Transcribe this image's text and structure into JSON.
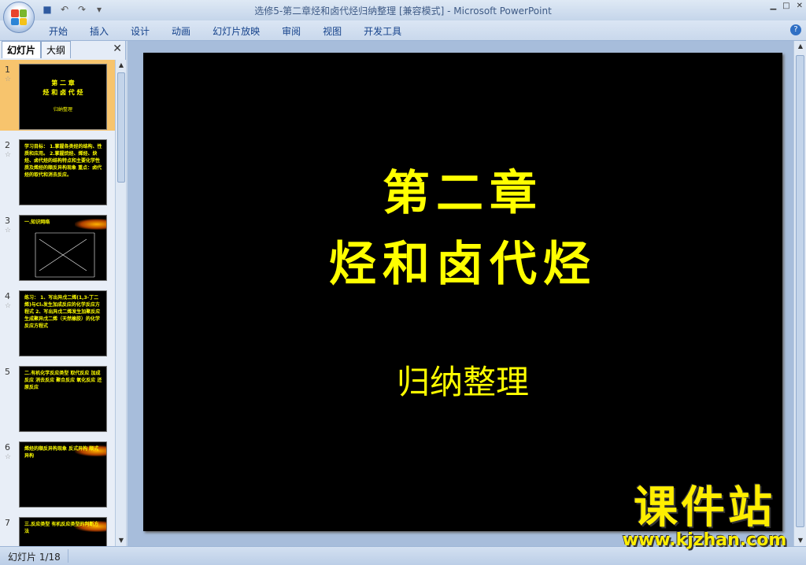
{
  "window": {
    "title": "选修5-第二章烃和卤代烃归纳整理 [兼容模式] - Microsoft PowerPoint"
  },
  "ribbon": {
    "tabs": [
      "开始",
      "插入",
      "设计",
      "动画",
      "幻灯片放映",
      "审阅",
      "视图",
      "开发工具"
    ]
  },
  "panel": {
    "tab_slides": "幻灯片",
    "tab_outline": "大纲"
  },
  "thumbnails": [
    {
      "num": "1",
      "lines": [
        "第 二 章",
        "烃 和 卤 代 烃",
        "归纳整理"
      ]
    },
    {
      "num": "2",
      "text": "学习目标： 1.掌握各类烃的结构、性质和应用。 2.掌握烷烃、烯烃、炔烃、卤代烃的结构特点和主要化学性质及烯烃的顺反异构现象 重点：卤代烃的取代和消去反应。"
    },
    {
      "num": "3",
      "text": "一.知识网络"
    },
    {
      "num": "4",
      "text": "练习： 1、写出异戊二烯(1,3-丁二烯)与Cl₂发生加成反应的化学反应方程式 2、写出异戊二烯发生加聚反应生成聚异戊二烯（天然橡胶）的化学反应方程式"
    },
    {
      "num": "5",
      "text": "二.有机化学反应类型 取代反应 加成反应 消去反应 聚合反应 氧化反应 还原反应"
    },
    {
      "num": "6",
      "text": "烯烃的顺反异构现象 反式异构 顺式异构"
    },
    {
      "num": "7",
      "text": "三.反应类型 有机反应类型的判断方法"
    }
  ],
  "slide": {
    "title_line1": "第二章",
    "title_line2": "烃和卤代烃",
    "subtitle": "归纳整理",
    "title_color": "#ffff00"
  },
  "status": {
    "text": "幻灯片 1/18"
  },
  "watermark": {
    "line1": "课件站",
    "line2": "www.kjzhan.com"
  }
}
